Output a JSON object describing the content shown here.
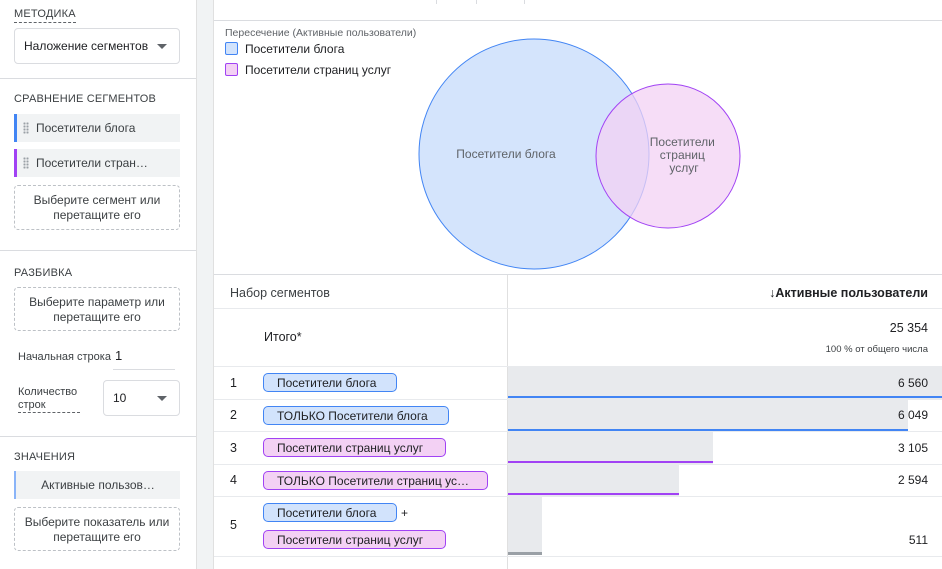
{
  "colors": {
    "blue": "#4285f4",
    "blue_fill": "#d2e3fc",
    "purple": "#a142f4",
    "purple_fill": "#f3d1f4",
    "gray_bar": "#9aa0a6"
  },
  "settings": {
    "technique": {
      "title": "МЕТОДИКА",
      "value": "Наложение сегментов"
    },
    "segment_comparison": {
      "title": "СРАВНЕНИЕ СЕГМЕНТОВ",
      "items": [
        "Посетители блога",
        "Посетители стран…"
      ],
      "dropzone": "Выберите сегмент или перетащите его"
    },
    "breakdown": {
      "title": "РАЗБИВКА",
      "dropzone": "Выберите параметр или перетащите его",
      "start_row_label": "Начальная строка",
      "start_row_value": "1",
      "rows_count_label": "Количество строк",
      "rows_count_value": "10"
    },
    "values": {
      "title": "ЗНАЧЕНИЯ",
      "metric": "Активные пользов…",
      "dropzone": "Выберите показатель или перетащите его"
    }
  },
  "venn": {
    "title": "Пересечение (Активные пользователи)",
    "legend": [
      "Посетители блога",
      "Посетители страниц услуг"
    ],
    "circle_a_label": "Посетители блога",
    "circle_b_label": "Посетители страниц услуг",
    "circle_b_label_lines": [
      "Посетители",
      "страниц",
      "услуг"
    ]
  },
  "table": {
    "col_segments": "Набор сегментов",
    "col_metric": "Активные пользователи",
    "sort_icon": "arrow-down-icon",
    "total_label": "Итого*",
    "total_value": "25 354",
    "total_sub": "100 % от общего числа",
    "rows": [
      {
        "num": "1",
        "segments": [
          "Посетители блога"
        ],
        "value": "6 560",
        "fraction": 1.0
      },
      {
        "num": "2",
        "segments": [
          "ТОЛЬКО Посетители блога"
        ],
        "value": "6 049",
        "fraction": 0.922
      },
      {
        "num": "3",
        "segments": [
          "Посетители страниц услуг"
        ],
        "value": "3 105",
        "fraction": 0.473
      },
      {
        "num": "4",
        "segments": [
          "ТОЛЬКО Посетители страниц ус…"
        ],
        "value": "2 594",
        "fraction": 0.395
      },
      {
        "num": "5",
        "segments": [
          "Посетители блога",
          "Посетители страниц услуг"
        ],
        "joiner": "+",
        "value": "511",
        "fraction": 0.078
      }
    ]
  }
}
